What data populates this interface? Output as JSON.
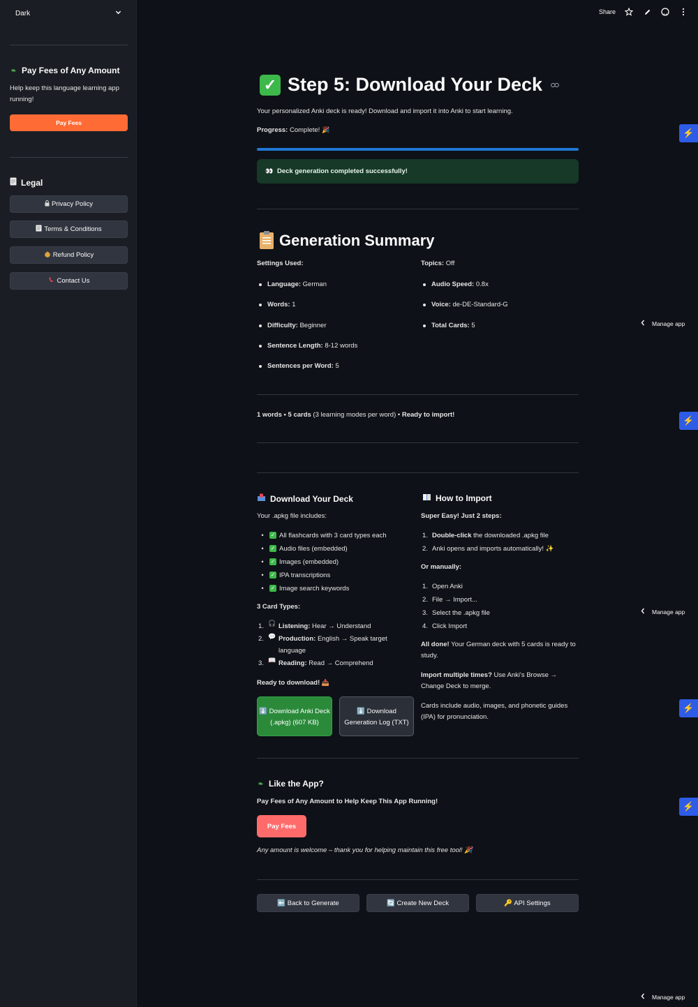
{
  "sidebar": {
    "theme_value": "Dark",
    "pay_heading": "Pay Fees of Any Amount",
    "pay_text": "Help keep this language learning app running!",
    "pay_button": "Pay Fees",
    "legal_heading": "Legal",
    "legal_items": [
      {
        "icon": "lock-icon",
        "label": "Privacy Policy"
      },
      {
        "icon": "clipboard-icon",
        "label": "Terms & Conditions"
      },
      {
        "icon": "money-bag-icon",
        "label": "Refund Policy"
      },
      {
        "icon": "phone-icon",
        "label": "Contact Us"
      }
    ]
  },
  "toolbar": {
    "share": "Share"
  },
  "step": {
    "title": "Step 5: Download Your Deck",
    "subtitle": "Your personalized Anki deck is ready! Download and import it into Anki to start learning.",
    "progress_label": "Progress:",
    "progress_value": "Complete!",
    "progress_fraction": 1.0,
    "success_message": "Deck generation completed successfully!"
  },
  "summary": {
    "title": "Generation Summary",
    "settings_used": "Settings Used:",
    "topics_label": "Topics:",
    "topics_value": "Off",
    "left_items": [
      {
        "label": "Language:",
        "value": "German"
      },
      {
        "label": "Words:",
        "value": "1"
      },
      {
        "label": "Difficulty:",
        "value": "Beginner"
      },
      {
        "label": "Sentence Length:",
        "value": "8-12 words"
      },
      {
        "label": "Sentences per Word:",
        "value": "5"
      }
    ],
    "right_items": [
      {
        "label": "Audio Speed:",
        "value": "0.8x"
      },
      {
        "label": "Voice:",
        "value": "de-DE-Standard-G"
      },
      {
        "label": "Total Cards:",
        "value": "5"
      }
    ],
    "stats_words": "1 words",
    "stats_sep": " • ",
    "stats_cards": "5 cards",
    "stats_note": " (3 learning modes per word) • ",
    "stats_ready": "Ready to import!"
  },
  "download": {
    "title": "Download Your Deck",
    "includes": "Your .apkg file includes:",
    "items": [
      "All flashcards with 3 card types each",
      "Audio files (embedded)",
      "Images (embedded)",
      "IPA transcriptions",
      "Image search keywords"
    ],
    "card_types_title": "3 Card Types:",
    "card_types": [
      {
        "num": "1.",
        "icon": "headphones-icon",
        "label": "Listening:",
        "text": "Hear → Understand"
      },
      {
        "num": "2.",
        "icon": "speech-bubble-icon",
        "label": "Production:",
        "text": "English → Speak target language"
      },
      {
        "num": "3.",
        "icon": "book-icon",
        "label": "Reading:",
        "text": "Read → Comprehend"
      }
    ],
    "ready": "Ready to download!",
    "btn_deck": "⬇️ Download Anki Deck (.apkg) (607 KB)",
    "btn_log": "⬇️ Download Generation Log (TXT)"
  },
  "import": {
    "title": "How to Import",
    "easy_bold": "Super Easy! Just 2 steps:",
    "easy_steps": [
      {
        "num": "1.",
        "bold": "Double-click",
        "text": " the downloaded .apkg file"
      },
      {
        "num": "2.",
        "bold": "",
        "text": "Anki opens and imports automatically! ✨"
      }
    ],
    "manual_title": "Or manually:",
    "manual_steps": [
      {
        "num": "1.",
        "text": "Open Anki"
      },
      {
        "num": "2.",
        "text": "File → Import..."
      },
      {
        "num": "3.",
        "text": "Select the .apkg file"
      },
      {
        "num": "4.",
        "text": "Click Import"
      }
    ],
    "done_bold": "All done!",
    "done_text": " Your German deck with 5 cards is ready to study.",
    "multi_bold": "Import multiple times?",
    "multi_text": " Use Anki's Browse → Change Deck to merge.",
    "cards_note": "Cards include audio, images, and phonetic guides (IPA) for pronunciation."
  },
  "like": {
    "title": "Like the App?",
    "subtitle": "Pay Fees of Any Amount to Help Keep This App Running!",
    "button": "Pay Fees",
    "thanks": "Any amount is welcome – thank you for helping maintain this free tool! 🎉"
  },
  "nav": {
    "back": "⬅️ Back to Generate",
    "new": "🔄 Create New Deck",
    "api": "🔑 API Settings"
  },
  "manage_app": "Manage app",
  "colors": {
    "accent_orange": "#ff6b35",
    "accent_red": "#ff6b6b",
    "progress_blue": "#1f77d4",
    "success_bg": "#173928",
    "download_green": "#2a8a3a"
  }
}
